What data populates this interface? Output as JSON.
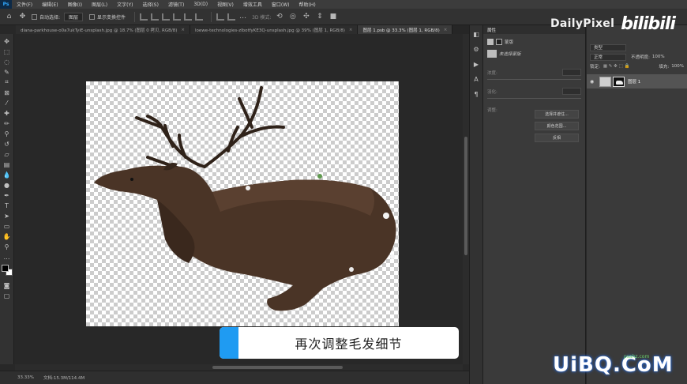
{
  "app": {
    "logo": "Ps"
  },
  "menu": [
    "文件(F)",
    "编辑(E)",
    "图像(I)",
    "图层(L)",
    "文字(Y)",
    "选择(S)",
    "滤镜(T)",
    "3D(D)",
    "视图(V)",
    "增效工具",
    "窗口(W)",
    "帮助(H)"
  ],
  "options": {
    "auto_select_label": "自动选择:",
    "auto_select_value": "图层",
    "transform_label": "显示变换控件",
    "mode_3d": "3D 模式:"
  },
  "brand": {
    "name": "DailyPixel",
    "bili": "bilibili"
  },
  "tabs": [
    {
      "label": "diana-parkhouse-o0a7ukTyiE-unsplash.jpg @ 18.7% (图层 0 拷贝, RGB/8)",
      "active": false
    },
    {
      "label": "loewe-technologies-zlbotfyKE3Q-unsplash.jpg @ 39% (图层 1, RGB/8)",
      "active": false
    },
    {
      "label": "图层 1.psb @ 33.3% (图层 1, RGB/8)",
      "active": true
    }
  ],
  "status": {
    "zoom": "33.33%",
    "doc": "文档:15.3M/114.4M"
  },
  "subtitle": "再次调整毛发细节",
  "properties": {
    "title": "属性",
    "mask_label": "蒙版",
    "selected_mask": "未选择蒙版",
    "density": "浓度:",
    "feather": "羽化:",
    "adjust": "调整:",
    "btn_select": "选择并遮住...",
    "btn_color": "颜色范围...",
    "btn_invert": "反相"
  },
  "layers": {
    "filter_value": "类型",
    "blend_mode": "正常",
    "opacity_label": "不透明度:",
    "opacity_value": "100%",
    "lock_label": "锁定:",
    "fill_label": "填充:",
    "fill_value": "100%",
    "layer_name": "图层 1"
  },
  "watermark": {
    "main": "UiBQ.CoM",
    "small": "psahz.com"
  }
}
